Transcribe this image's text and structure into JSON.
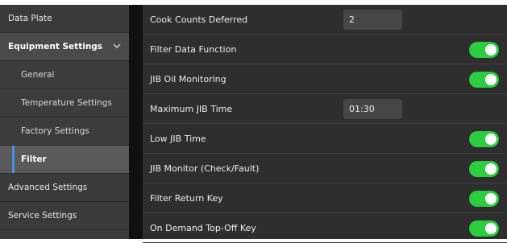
{
  "sidebar": {
    "items": [
      {
        "label": "Data Plate"
      },
      {
        "label": "Equipment Settings"
      },
      {
        "label": "General"
      },
      {
        "label": "Temperature Settings"
      },
      {
        "label": "Factory Settings"
      },
      {
        "label": "Filter"
      },
      {
        "label": "Advanced Settings"
      },
      {
        "label": "Service Settings"
      }
    ],
    "active_item": "Filter",
    "accent_color": "#4a90e2"
  },
  "settings": {
    "rows": [
      {
        "label": "Cook Counts Deferred",
        "value": "2"
      },
      {
        "label": "Filter Data Function",
        "toggle": "on"
      },
      {
        "label": "JIB Oil Monitoring",
        "toggle": "on"
      },
      {
        "label": "Maximum JIB Time",
        "value": "01:30"
      },
      {
        "label": "Low JIB Time",
        "toggle": "on"
      },
      {
        "label": "JIB Monitor (Check/Fault)",
        "toggle": "on"
      },
      {
        "label": "Filter Return Key",
        "toggle": "on"
      },
      {
        "label": "On Demand Top-Off Key",
        "toggle": "on"
      }
    ],
    "toggle_on_color": "#2ecc40"
  }
}
